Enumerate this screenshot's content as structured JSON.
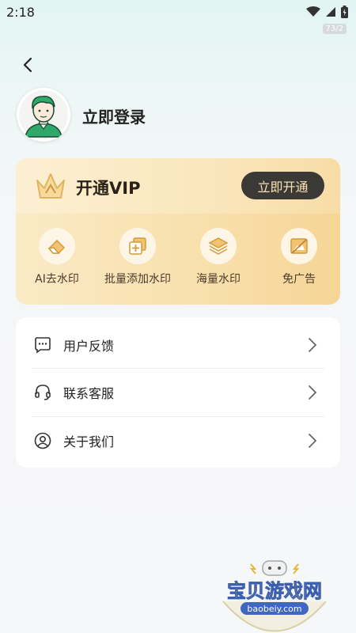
{
  "status_bar": {
    "time": "2:18",
    "badge": "73/2"
  },
  "header": {
    "back_icon": "back-arrow-icon"
  },
  "profile": {
    "login_text": "立即登录",
    "avatar_icon": "user-avatar-icon"
  },
  "vip": {
    "title": "开通VIP",
    "button_label": "立即开通",
    "features": [
      {
        "icon": "eraser-icon",
        "label": "AI去水印"
      },
      {
        "icon": "add-watermark-icon",
        "label": "批量添加水印"
      },
      {
        "icon": "layers-icon",
        "label": "海量水印"
      },
      {
        "icon": "no-ads-icon",
        "label": "免广告"
      }
    ]
  },
  "menu": {
    "items": [
      {
        "icon": "chat-feedback-icon",
        "label": "用户反馈"
      },
      {
        "icon": "headset-icon",
        "label": "联系客服"
      },
      {
        "icon": "user-circle-icon",
        "label": "关于我们"
      }
    ]
  },
  "watermark": {
    "site_name": "宝贝游戏网",
    "site_url": "baobeiy.com"
  },
  "colors": {
    "vip_gold": "#f8e0ad",
    "vip_button": "#3a3936",
    "vip_button_text": "#fbe2b4",
    "avatar_green": "#2fa86a"
  }
}
